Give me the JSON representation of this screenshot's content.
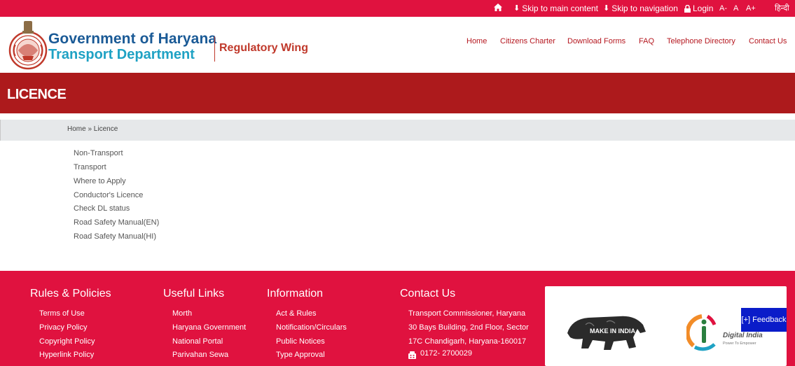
{
  "topbar": {
    "skip_main": "Skip to main content",
    "skip_nav": "Skip to navigation",
    "login": "Login",
    "font_small": "A-",
    "font_normal": "A",
    "font_large": "A+",
    "hindi": "हिन्दी"
  },
  "header": {
    "gov_title": "Government of Haryana",
    "dept_title": "Transport Department",
    "wing_title": "Regulatory Wing",
    "nav": [
      "Home",
      "Citizens Charter",
      "Download Forms",
      "FAQ",
      "Telephone Directory",
      "Contact Us"
    ]
  },
  "banner": {
    "title": "LICENCE"
  },
  "breadcrumb": {
    "text": "Home » Licence"
  },
  "links": [
    "Non-Transport",
    "Transport",
    "Where to Apply",
    "Conductor's Licence",
    "Check DL status",
    "Road Safety Manual(EN)",
    "Road Safety Manual(HI)"
  ],
  "footer": {
    "rules": {
      "heading": "Rules & Policies",
      "items": [
        "Terms of Use",
        "Privacy Policy",
        "Copyright Policy",
        "Hyperlink Policy"
      ]
    },
    "useful": {
      "heading": "Useful Links",
      "items": [
        "Morth",
        "Haryana Government",
        "National Portal",
        "Parivahan Sewa"
      ]
    },
    "info": {
      "heading": "Information",
      "items": [
        "Act & Rules",
        "Notification/Circulars",
        "Public Notices",
        "Type Approval"
      ]
    },
    "contact": {
      "heading": "Contact Us",
      "lines": [
        "Transport Commissioner, Haryana",
        "30 Bays Building, 2nd Floor, Sector",
        "17C Chandigarh, Haryana-160017"
      ],
      "phone": "0172- 2700029"
    }
  },
  "logos": {
    "make_in_india": "MAKE IN INDIA",
    "digital_india": "Digital India",
    "digital_india_tagline": "Power To Empower"
  },
  "feedback": {
    "label": "[+] Feedback"
  },
  "colors": {
    "topbar": "#e0123f",
    "banner": "#ad1a1c",
    "footer": "#e0123f",
    "gov_blue": "#1a5a96",
    "dept_cyan": "#1fa2c4",
    "wing_red": "#c0392b"
  }
}
